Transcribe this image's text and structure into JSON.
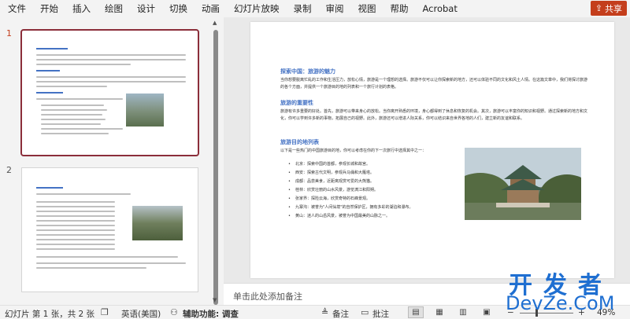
{
  "menu": [
    "文件",
    "开始",
    "插入",
    "绘图",
    "设计",
    "切换",
    "动画",
    "幻灯片放映",
    "录制",
    "审阅",
    "视图",
    "帮助",
    "Acrobat"
  ],
  "share": {
    "label": "共享",
    "icon": "share-icon"
  },
  "thumbnails": [
    {
      "number": "1"
    },
    {
      "number": "2"
    }
  ],
  "slide": {
    "heading1": "探索中国：旅游的魅力",
    "para1": "当你想要脱离忙乱的工作和生活压力，放松心情，旅游是一个理想的选择。旅游不仅可以让你探索新的地方，还可以体验不同的文化和风土人情。在这篇文章中，我们将探讨旅游的各个方面，并提供一个旅游目的地的列表和一个旅行计划的表格。",
    "heading2": "旅游的重要性",
    "para2": "旅游有许多重要的好处。首先，旅游可以带来身心的放松。当你离开熟悉的环境，身心都得到了休息和恢复的机会。其次，旅游可以丰富你的知识和视野。通过探索新的地方和文化，你可以学到许多新的事物，拓展自己的视野。此外，旅游还可以增进人际关系，你可以结识来自世界各地的人们，建立新的友谊和联系。",
    "heading3": "旅游目的地列表",
    "para3": "以下是一些热门的中国旅游目的地，你可以考虑在你的下一次旅行中选择其中之一：",
    "destinations": [
      "北京：探索中国的首都，参观长城和故宫。",
      "西安：探索古代文明，参观兵马俑和大雁塔。",
      "成都：品尝美食，近距离观赏可爱的大熊猫。",
      "桂林：欣赏壮丽的山水风景，游览漓江和阳朔。",
      "张家界：探险云海，欣赏奇特的石峰景观。",
      "九寨沟：被誉为\"人间仙境\"的自然保护区，拥有多彩的湖泊和瀑布。",
      "黄山：迷人的山岳风景，被誉为中国最美的山脉之一。"
    ]
  },
  "notes": {
    "placeholder": "单击此处添加备注"
  },
  "status": {
    "slide_info": "幻灯片 第 1 张，共 2 张",
    "language": "英语(美国)",
    "accessibility": "辅助功能: 调查",
    "notes_btn": "备注",
    "comments_btn": "批注",
    "zoom": "49%"
  },
  "watermark": {
    "top": "开发者",
    "bottom": "DevZe.CoM"
  }
}
